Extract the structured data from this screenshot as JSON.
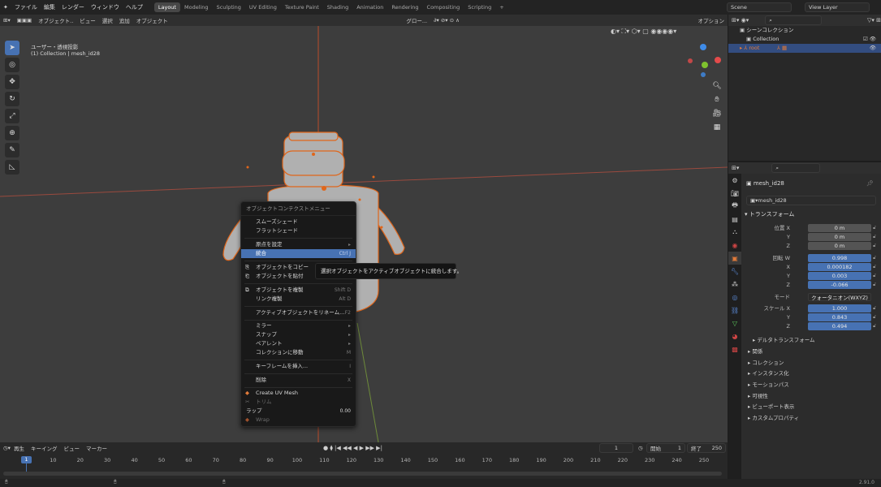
{
  "topbar": {
    "menus": [
      "ファイル",
      "編集",
      "レンダー",
      "ウィンドウ",
      "ヘルプ"
    ],
    "workspaces": [
      "Layout",
      "Modeling",
      "Sculpting",
      "UV Editing",
      "Texture Paint",
      "Shading",
      "Animation",
      "Rendering",
      "Compositing",
      "Scripting"
    ],
    "scene": "Scene",
    "view_layer": "View Layer"
  },
  "viewport": {
    "header": {
      "mode": "オブジェクト..",
      "menus": [
        "ビュー",
        "選択",
        "追加",
        "オブジェクト"
      ],
      "transform": "グロー...",
      "options": "オプション"
    },
    "overlay_title": "ユーザー・透視投影",
    "overlay_sub": "(1) Collection | mesh_id28"
  },
  "context_menu": {
    "title": "オブジェクトコンテクストメニュー",
    "items": [
      {
        "label": "スムーズシェード",
        "shortcut": ""
      },
      {
        "label": "フラットシェード",
        "shortcut": ""
      },
      {
        "label": "原点を設定",
        "shortcut": "▸"
      },
      {
        "label": "統合",
        "shortcut": "Ctrl J"
      },
      {
        "label": "オブジェクトをコピー",
        "shortcut": ""
      },
      {
        "label": "オブジェクトを貼付",
        "shortcut": ""
      },
      {
        "label": "オブジェクトを複製",
        "shortcut": "Shift D"
      },
      {
        "label": "リンク複製",
        "shortcut": "Alt D"
      },
      {
        "label": "アクティブオブジェクトをリネーム...",
        "shortcut": "F2"
      },
      {
        "label": "ミラー",
        "shortcut": "▸"
      },
      {
        "label": "スナップ",
        "shortcut": "▸"
      },
      {
        "label": "ペアレント",
        "shortcut": "▸"
      },
      {
        "label": "コレクションに移動",
        "shortcut": "M"
      },
      {
        "label": "キーフレームを挿入...",
        "shortcut": "I"
      },
      {
        "label": "削除",
        "shortcut": "X"
      },
      {
        "label": "Create UV Mesh",
        "shortcut": ""
      },
      {
        "label": "トリム",
        "shortcut": ""
      },
      {
        "label": "ラップ",
        "shortcut": "0.00"
      },
      {
        "label": "Wrap",
        "shortcut": ""
      }
    ]
  },
  "tooltip": "選択オブジェクトをアクティブオブジェクトに統合します。",
  "outliner": {
    "scene_collection": "シーンコレクション",
    "collection": "Collection",
    "root": "root"
  },
  "properties": {
    "object": "mesh_id28",
    "data": "mesh_id28",
    "transform": "トランスフォーム",
    "location": {
      "label": "位置 X",
      "x": "0 m",
      "y": "0 m",
      "z": "0 m"
    },
    "rotation": {
      "label": "回転 W",
      "w": "0.998",
      "x": "0.000182",
      "y": "0.003",
      "z": "-0.066"
    },
    "mode_label": "モード",
    "mode": "クォータニオン(WXYZ)",
    "scale": {
      "label": "スケール X",
      "x": "1.000",
      "y": "0.843",
      "z": "0.494"
    },
    "axis_y": "Y",
    "axis_z": "Z",
    "axis_x": "X",
    "panels": [
      "デルタトランスフォーム",
      "関係",
      "コレクション",
      "インスタンス化",
      "モーションパス",
      "可視性",
      "ビューポート表示",
      "カスタムプロパティ"
    ]
  },
  "timeline": {
    "menus": [
      "再生",
      "キーイング",
      "ビュー",
      "マーカー"
    ],
    "current": "1",
    "start_label": "開始",
    "start": "1",
    "end_label": "終了",
    "end": "250",
    "ticks": [
      "1",
      "10",
      "20",
      "30",
      "40",
      "50",
      "60",
      "70",
      "80",
      "90",
      "100",
      "110",
      "120",
      "130",
      "140",
      "150",
      "160",
      "170",
      "180",
      "190",
      "200",
      "210",
      "220",
      "230",
      "240",
      "250"
    ]
  },
  "status": {
    "version": "2.91.0"
  }
}
